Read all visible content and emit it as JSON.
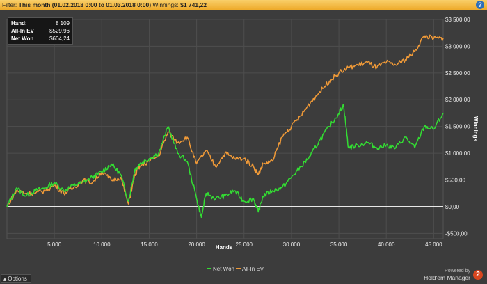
{
  "filter": {
    "label": "Filter:",
    "period": "This month (01.02.2018 0:00 to 01.03.2018 0:00)",
    "winnings_label": "Winnings:",
    "winnings_value": "$1 741,22"
  },
  "help_icon": "question-mark-icon",
  "stats": {
    "hands_label": "Hand:",
    "hands_value": "8 109",
    "allin_label": "All-In EV",
    "allin_value": "$529,96",
    "netwon_label": "Net Won",
    "netwon_value": "$604,24"
  },
  "options_label": "Options",
  "powered_by": "Powered by",
  "brand": "Hold'em Manager",
  "brand_badge": "2",
  "colors": {
    "net_won": "#33dd33",
    "all_in_ev": "#f09a38",
    "zero_line": "#ffffff",
    "background": "#3c3c3c",
    "grid": "#4e4e4e",
    "filter_bar": "#f5bd48"
  },
  "chart_data": {
    "type": "line",
    "xlabel": "Hands",
    "ylabel": "Winnings",
    "xlim": [
      0,
      46000
    ],
    "ylim": [
      -600,
      3500
    ],
    "grid": true,
    "legend_position": "bottom-center",
    "x_ticks": [
      5000,
      10000,
      15000,
      20000,
      25000,
      30000,
      35000,
      40000,
      45000
    ],
    "x_tick_labels": [
      "5 000",
      "10 000",
      "15 000",
      "20 000",
      "25 000",
      "30 000",
      "35 000",
      "40 000",
      "45 000"
    ],
    "y_ticks": [
      -500,
      0,
      500,
      1000,
      1500,
      2000,
      2500,
      3000,
      3500
    ],
    "y_tick_labels": [
      "-$500,00",
      "$0,00",
      "$500,00",
      "$1 000,00",
      "$1 500,00",
      "$2 000,00",
      "$2 500,00",
      "$3 000,00",
      "$3 500,00"
    ],
    "series": [
      {
        "name": "Net Won",
        "x": [
          0,
          1000,
          2000,
          3000,
          4000,
          5000,
          6000,
          7000,
          8000,
          9000,
          10000,
          11000,
          12000,
          12800,
          13500,
          14000,
          15000,
          16000,
          17000,
          18000,
          19000,
          20000,
          20500,
          21000,
          22000,
          23000,
          24000,
          25000,
          26000,
          26500,
          27000,
          28000,
          29000,
          30000,
          31000,
          32000,
          33000,
          34000,
          35000,
          35500,
          36000,
          37000,
          38000,
          39000,
          40000,
          41000,
          42000,
          43000,
          44000,
          45000,
          46000
        ],
        "y": [
          0,
          350,
          200,
          300,
          350,
          450,
          300,
          400,
          450,
          550,
          650,
          800,
          600,
          100,
          700,
          800,
          900,
          1000,
          1500,
          1000,
          850,
          150,
          -200,
          250,
          150,
          200,
          300,
          100,
          150,
          -100,
          200,
          300,
          350,
          550,
          750,
          950,
          1250,
          1500,
          1750,
          1900,
          1100,
          1150,
          1200,
          1100,
          1150,
          1100,
          1300,
          1100,
          1500,
          1450,
          1750
        ]
      },
      {
        "name": "All-In EV",
        "x": [
          0,
          1000,
          2000,
          3000,
          4000,
          5000,
          6000,
          7000,
          8000,
          9000,
          10000,
          11000,
          12000,
          12800,
          13500,
          14000,
          15000,
          16000,
          17000,
          18000,
          19000,
          20000,
          21000,
          22000,
          23000,
          24000,
          25000,
          26000,
          26500,
          27000,
          28000,
          29000,
          30000,
          31000,
          32000,
          33000,
          34000,
          35000,
          36000,
          37000,
          38000,
          39000,
          40000,
          41000,
          42000,
          43000,
          44000,
          45000,
          46000
        ],
        "y": [
          0,
          300,
          250,
          250,
          300,
          400,
          250,
          350,
          500,
          450,
          650,
          500,
          550,
          50,
          600,
          750,
          850,
          950,
          1400,
          1200,
          1300,
          800,
          1050,
          750,
          1000,
          900,
          900,
          750,
          600,
          800,
          850,
          1300,
          1500,
          1700,
          1950,
          2150,
          2350,
          2500,
          2600,
          2650,
          2700,
          2600,
          2700,
          2650,
          2750,
          2900,
          3200,
          3150,
          3150
        ]
      }
    ]
  }
}
